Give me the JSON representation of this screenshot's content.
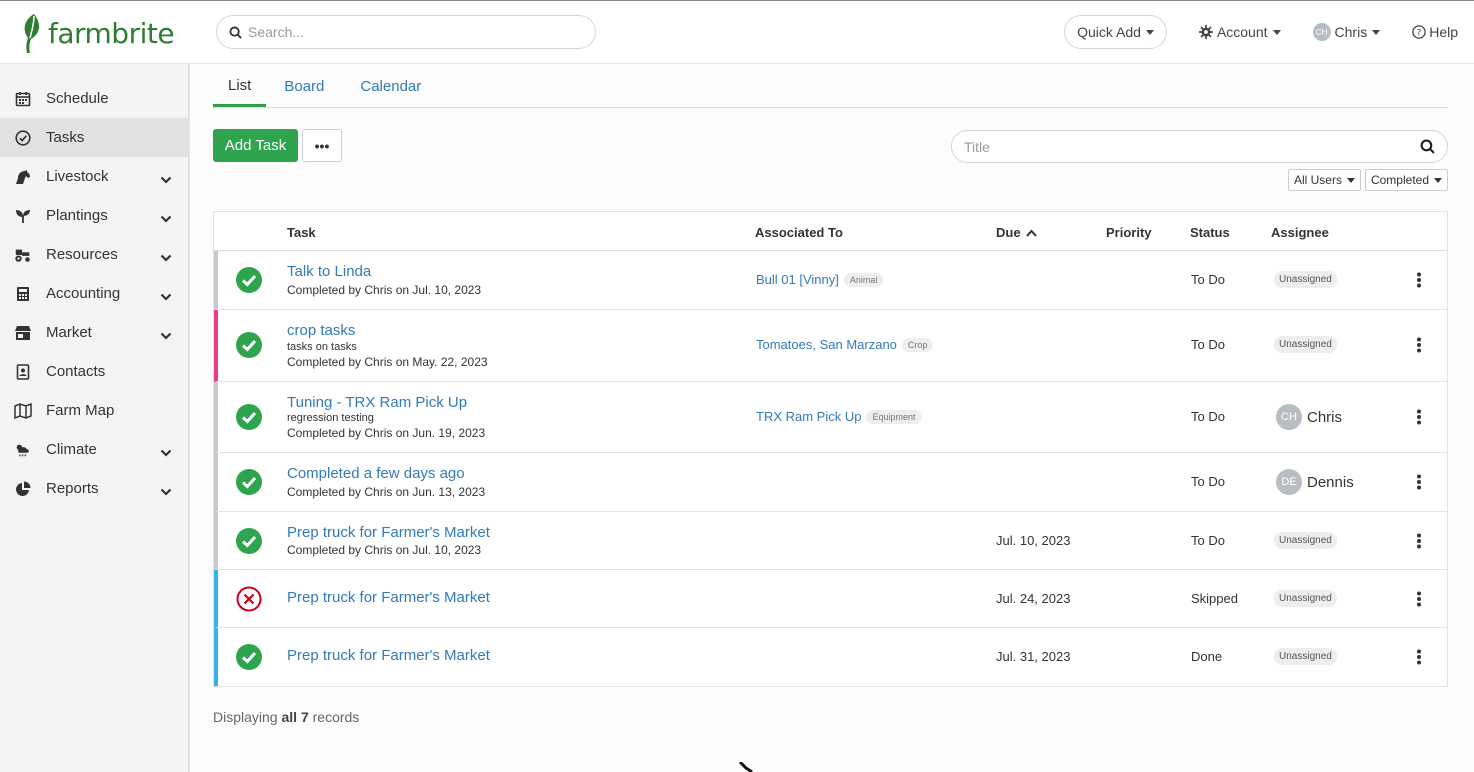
{
  "brand": {
    "name": "farmbrite",
    "color": "#2f7d32"
  },
  "header": {
    "search_placeholder": "Search...",
    "quick_add": "Quick Add",
    "account": "Account",
    "user": {
      "initials": "CH",
      "name": "Chris"
    },
    "help": "Help"
  },
  "sidebar": {
    "items": [
      {
        "label": "Schedule",
        "icon": "calendar-icon",
        "expandable": false
      },
      {
        "label": "Tasks",
        "icon": "check-circle-icon",
        "expandable": false,
        "active": true
      },
      {
        "label": "Livestock",
        "icon": "horse-icon",
        "expandable": true
      },
      {
        "label": "Plantings",
        "icon": "seedling-icon",
        "expandable": true
      },
      {
        "label": "Resources",
        "icon": "tractor-icon",
        "expandable": true
      },
      {
        "label": "Accounting",
        "icon": "calculator-icon",
        "expandable": true
      },
      {
        "label": "Market",
        "icon": "store-icon",
        "expandable": true
      },
      {
        "label": "Contacts",
        "icon": "address-book-icon",
        "expandable": false
      },
      {
        "label": "Farm Map",
        "icon": "map-icon",
        "expandable": false
      },
      {
        "label": "Climate",
        "icon": "cloud-sun-rain-icon",
        "expandable": true
      },
      {
        "label": "Reports",
        "icon": "pie-chart-icon",
        "expandable": true
      }
    ]
  },
  "tabs": [
    {
      "label": "List",
      "active": true
    },
    {
      "label": "Board",
      "active": false
    },
    {
      "label": "Calendar",
      "active": false
    }
  ],
  "toolbar": {
    "add_task": "Add Task",
    "more": "•••",
    "title_placeholder": "Title",
    "filter_users": "All Users",
    "filter_status": "Completed"
  },
  "table": {
    "headers": {
      "task": "Task",
      "associated": "Associated To",
      "due": "Due",
      "priority": "Priority",
      "status": "Status",
      "assignee": "Assignee"
    },
    "rows": [
      {
        "title": "Talk to Linda",
        "sub": "",
        "meta": "Completed by Chris on Jul. 10, 2023",
        "assoc": "Bull 01 [Vinny]",
        "assoc_tag": "Animal",
        "due": "",
        "status": "To Do",
        "assignee": "Unassigned",
        "result": "done",
        "color": "gray"
      },
      {
        "title": "crop tasks",
        "sub": "tasks on tasks",
        "meta": "Completed by Chris on May. 22, 2023",
        "assoc": "Tomatoes, San Marzano",
        "assoc_tag": "Crop",
        "due": "",
        "status": "To Do",
        "assignee": "Unassigned",
        "result": "done",
        "color": "pink"
      },
      {
        "title": "Tuning - TRX Ram Pick Up",
        "sub": "regression testing",
        "meta": "Completed by Chris on Jun. 19, 2023",
        "assoc": "TRX Ram Pick Up",
        "assoc_tag": "Equipment",
        "due": "",
        "status": "To Do",
        "assignee": "Chris",
        "assignee_initials": "CH",
        "result": "done",
        "color": "gray"
      },
      {
        "title": "Completed a few days ago",
        "sub": "",
        "meta": "Completed by Chris on Jun. 13, 2023",
        "assoc": "",
        "assoc_tag": "",
        "due": "",
        "status": "To Do",
        "assignee": "Dennis",
        "assignee_initials": "DE",
        "result": "done",
        "color": "gray"
      },
      {
        "title": "Prep truck for Farmer's Market",
        "sub": "",
        "meta": "Completed by Chris on Jul. 10, 2023",
        "assoc": "",
        "assoc_tag": "",
        "due": "Jul. 10, 2023",
        "status": "To Do",
        "assignee": "Unassigned",
        "result": "done",
        "color": "gray"
      },
      {
        "title": "Prep truck for Farmer's Market",
        "sub": "",
        "meta": "",
        "assoc": "",
        "assoc_tag": "",
        "due": "Jul. 24, 2023",
        "status": "Skipped",
        "assignee": "Unassigned",
        "result": "skipped",
        "color": "blue"
      },
      {
        "title": "Prep truck for Farmer's Market",
        "sub": "",
        "meta": "",
        "assoc": "",
        "assoc_tag": "",
        "due": "Jul. 31, 2023",
        "status": "Done",
        "assignee": "Unassigned",
        "result": "done",
        "color": "blue"
      }
    ]
  },
  "footer": {
    "prefix": "Displaying ",
    "all": "all 7",
    "suffix": " records"
  },
  "colors": {
    "accent": "#2ea44f",
    "link": "#337ab7",
    "done": "#2ea44f",
    "skipped": "#d0021b",
    "pink": "#e83e8c",
    "blue": "#36b3e8"
  }
}
